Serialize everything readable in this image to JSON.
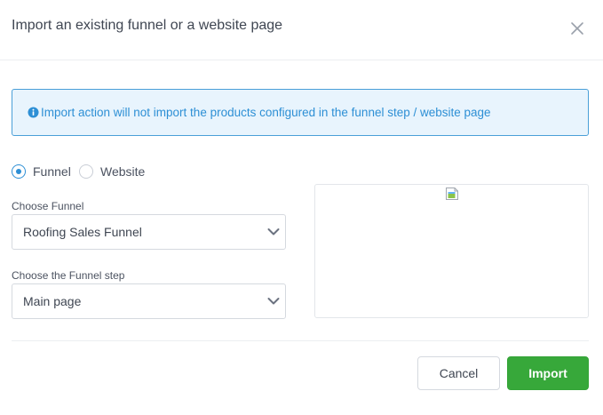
{
  "modal": {
    "title": "Import an existing funnel or a website page"
  },
  "alert": {
    "icon": "info-circle-icon",
    "text": "Import action will not import the products configured in the funnel step / website page",
    "color": "#2d8fd5"
  },
  "source_type": {
    "options": [
      {
        "label": "Funnel",
        "checked": true
      },
      {
        "label": "Website",
        "checked": false
      }
    ]
  },
  "funnel_select": {
    "label": "Choose Funnel",
    "value": "Roofing Sales Funnel"
  },
  "step_select": {
    "label": "Choose the Funnel step",
    "value": "Main page"
  },
  "actions": {
    "cancel_label": "Cancel",
    "import_label": "Import",
    "import_color": "#37a83a"
  }
}
